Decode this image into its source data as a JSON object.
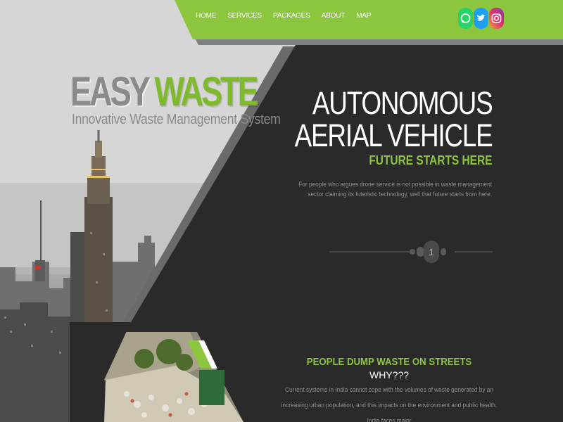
{
  "nav": {
    "links": [
      "HOME",
      "SERVICES",
      "PACKAGES",
      "ABOUT",
      "MAP"
    ]
  },
  "social": [
    {
      "name": "whatsapp-icon",
      "color": "#25d366",
      "glyph": "✆"
    },
    {
      "name": "twitter-icon",
      "color": "#1da1f2",
      "glyph": "t"
    },
    {
      "name": "instagram-icon",
      "color": "#c13584",
      "glyph": "◎"
    }
  ],
  "logo": {
    "word1": "EASY",
    "word2": "WASTE",
    "subtitle": "Innovative Waste Management System"
  },
  "hero": {
    "title_line1": "AUTONOMOUS",
    "title_line2": "AERIAL VEHICLE",
    "tagline": "FUTURE STARTS HERE",
    "description": "For people who argues drone service is not possible in waste management sector claiming its futeristic technology, well that future starts from here."
  },
  "pager": {
    "current": "1"
  },
  "problem": {
    "title": "PEOPLE DUMP WASTE ON STREETS",
    "subtitle": "WHY???",
    "body": "Current systems in India cannot cope with the volumes of waste generated by an increasing urban population, and this impacts on the environment and public health. India faces major"
  },
  "colors": {
    "accent_green": "#8cc63f",
    "dark_panel": "#2a2a2a",
    "nav_green": "#8cc63f"
  }
}
